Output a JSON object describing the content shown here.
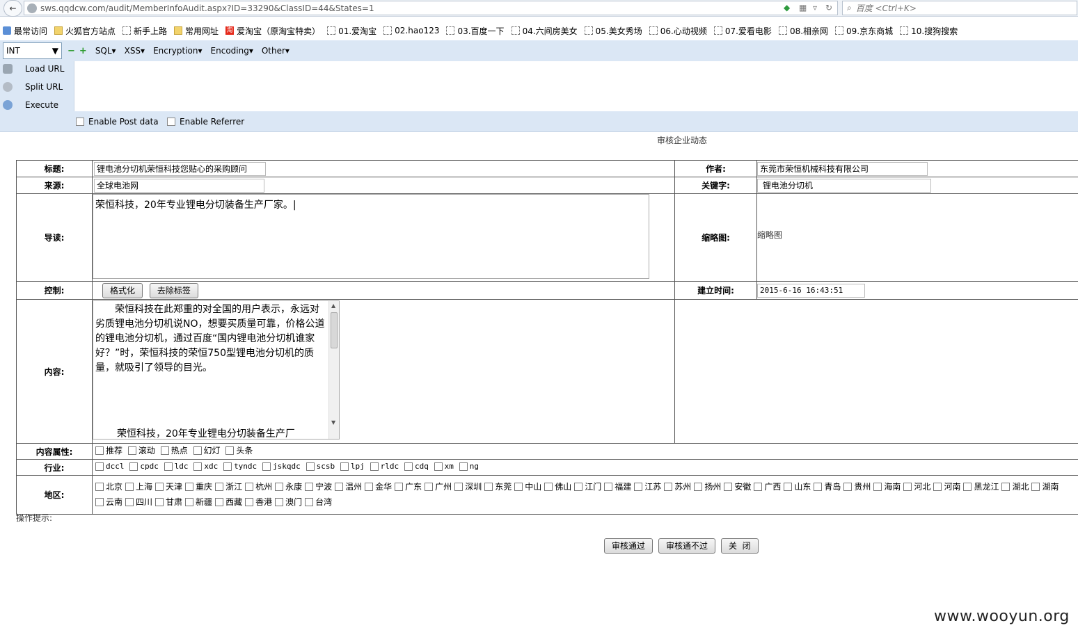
{
  "browser": {
    "url": "sws.qqdcw.com/audit/MemberInfoAudit.aspx?ID=33290&ClassID=44&States=1",
    "search_placeholder": "百度 <Ctrl+K>"
  },
  "bookmarks": [
    {
      "label": "最常访问",
      "icon": "star-icon"
    },
    {
      "label": "火狐官方站点",
      "icon": "folder-icon"
    },
    {
      "label": "新手上路",
      "icon": "page-icon"
    },
    {
      "label": "常用网址",
      "icon": "folder-icon"
    },
    {
      "label": "爱淘宝（原淘宝特卖）",
      "icon": "taobao-icon"
    },
    {
      "label": "01.爱淘宝",
      "icon": "page-icon"
    },
    {
      "label": "02.hao123",
      "icon": "page-icon"
    },
    {
      "label": "03.百度一下",
      "icon": "page-icon"
    },
    {
      "label": "04.六间房美女",
      "icon": "page-icon"
    },
    {
      "label": "05.美女秀场",
      "icon": "page-icon"
    },
    {
      "label": "06.心动视频",
      "icon": "page-icon"
    },
    {
      "label": "07.爱看电影",
      "icon": "page-icon"
    },
    {
      "label": "08.相亲网",
      "icon": "page-icon"
    },
    {
      "label": "09.京东商城",
      "icon": "page-icon"
    },
    {
      "label": "10.搜狗搜索",
      "icon": "page-icon"
    }
  ],
  "hackbar": {
    "type_select": "INT",
    "menus": [
      "SQL▾",
      "XSS▾",
      "Encryption▾",
      "Encoding▾",
      "Other▾"
    ],
    "actions": [
      "Load URL",
      "Split URL",
      "Execute"
    ],
    "checks": [
      "Enable Post data",
      "Enable Referrer"
    ]
  },
  "page": {
    "heading": "审核企业动态",
    "labels": {
      "title": "标题:",
      "author": "作者:",
      "source": "来源:",
      "keywords": "关键字:",
      "intro": "导读:",
      "thumbnail": "缩略图:",
      "control": "控制:",
      "created": "建立时间:",
      "content": "内容:",
      "attributes": "内容属性:",
      "industry": "行业:",
      "region": "地区:"
    },
    "values": {
      "title": "锂电池分切机荣恒科技您贴心的采购顾问",
      "author": "东莞市荣恒机械科技有限公司",
      "source": "全球电池网",
      "keywords": " 锂电池分切机",
      "intro": "荣恒科技，20年专业锂电分切装备生产厂家。|",
      "thumbnail": "缩略图",
      "created": "2015-6-16 16:43:51",
      "content_p1": "荣恒科技在此郑重的对全国的用户表示，永远对劣质锂电池分切机说NO，想要买质量可靠，价格公道的锂电池分切机，通过百度“国内锂电池分切机谁家好？”时，荣恒科技的荣恒750型锂电池分切机的质量，就吸引了领导的目光。",
      "content_p2": "荣恒科技，20年专业锂电分切装备生产厂"
    },
    "control_buttons": [
      "格式化",
      "去除标签"
    ],
    "attributes": [
      "推荐",
      "滚动",
      "热点",
      "幻灯",
      "头条"
    ],
    "industries": [
      "dccl",
      "cpdc",
      "ldc",
      "xdc",
      "tyndc",
      "jskqdc",
      "scsb",
      "lpj",
      "rldc",
      "cdq",
      "xm",
      "ng"
    ],
    "regions_row1": [
      "北京",
      "上海",
      "天津",
      "重庆",
      "浙江",
      "杭州",
      "永康",
      "宁波",
      "温州",
      "金华",
      "广东",
      "广州",
      "深圳",
      "东莞",
      "中山",
      "佛山",
      "江门",
      "福建",
      "江苏",
      "苏州",
      "扬州",
      "安徽",
      "广西",
      "山东",
      "青岛",
      "贵州",
      "海南",
      "河北",
      "河南",
      "黑龙江",
      "湖北",
      "湖南"
    ],
    "regions_row2": [
      "云南",
      "四川",
      "甘肃",
      "新疆",
      "西藏",
      "香港",
      "澳门",
      "台湾"
    ],
    "hint": "操作提示:",
    "bottom_buttons": [
      "审核通过",
      "审核通不过",
      "关  闭"
    ]
  },
  "watermark": "www.wooyun.org"
}
